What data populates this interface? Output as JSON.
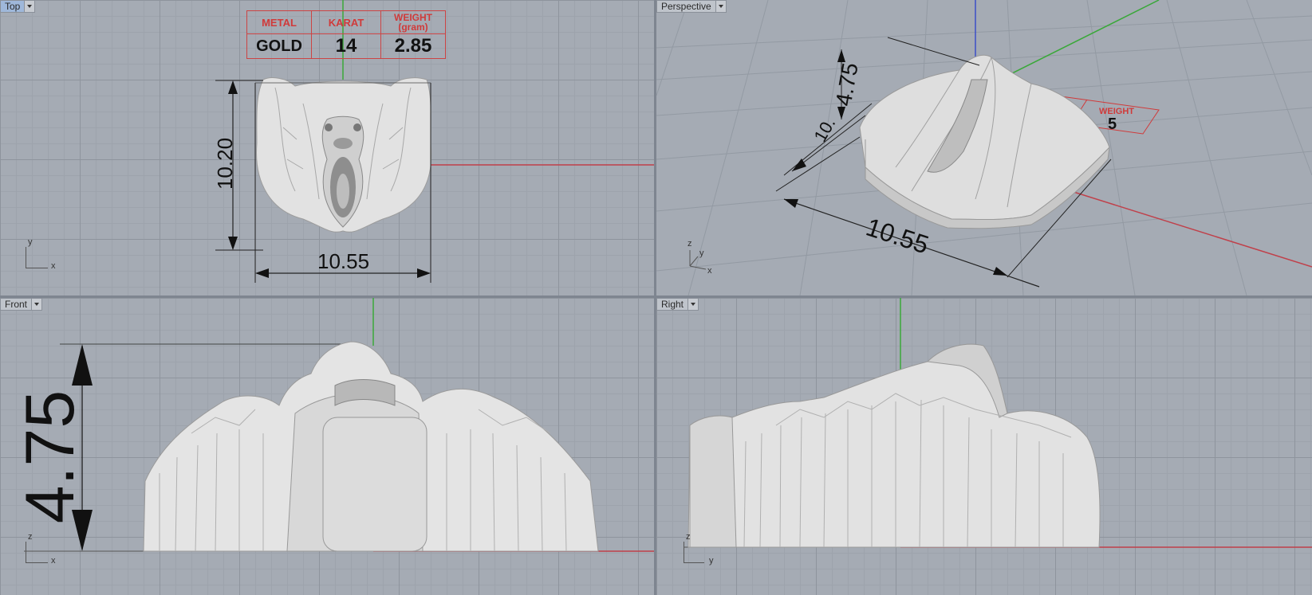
{
  "viewports": {
    "top": {
      "label": "Top"
    },
    "perspective": {
      "label": "Perspective"
    },
    "front": {
      "label": "Front"
    },
    "right": {
      "label": "Right"
    }
  },
  "info_table": {
    "headers": [
      "METAL",
      "KARAT",
      "WEIGHT\n(gram)"
    ],
    "values": [
      "GOLD",
      "14",
      "2.85"
    ]
  },
  "dimensions": {
    "top_height": "10.20",
    "top_width": "10.55",
    "persp_depth": "4.75",
    "persp_height": "10.",
    "persp_width": "10.55",
    "persp_tag_value": "5",
    "front_depth": "4.75"
  },
  "axes": {
    "top": [
      "y",
      "x"
    ],
    "perspective": [
      "z",
      "y",
      "x"
    ],
    "front": [
      "z",
      "x"
    ],
    "right": [
      "z",
      "y"
    ]
  },
  "colors": {
    "x_axis": "#c0404a",
    "y_axis": "#3aa83a",
    "z_axis": "#3b4fc8",
    "model": "#e6e6e6",
    "table_red": "#d03a3a"
  }
}
